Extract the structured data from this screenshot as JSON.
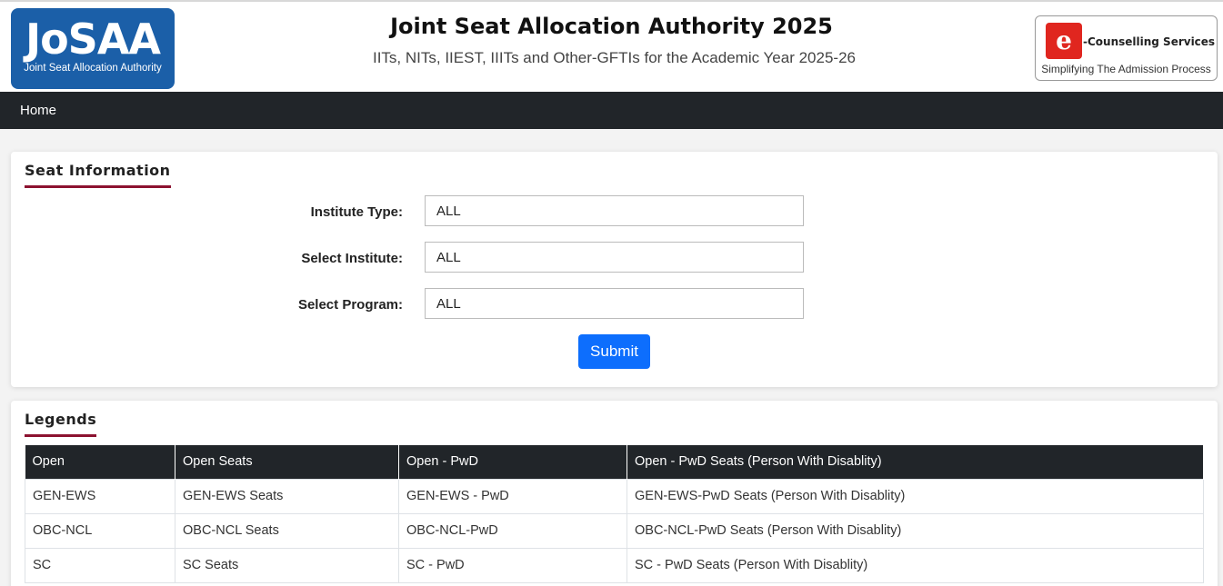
{
  "header": {
    "logo_text": "JoSAA",
    "logo_subtitle": "Joint Seat Allocation Authority",
    "title": "Joint Seat Allocation Authority 2025",
    "subtitle": "IITs, NITs, IIEST, IIITs and Other-GFTIs for the Academic Year 2025-26",
    "ecounselling_badge": "e",
    "ecounselling_label": "-Counselling Services",
    "ecounselling_tagline": "Simplifying The Admission Process"
  },
  "nav": {
    "home": "Home"
  },
  "seat_info": {
    "title": "Seat Information",
    "institute_type_label": "Institute Type:",
    "institute_type_value": "ALL",
    "institute_label": "Select Institute:",
    "institute_value": "ALL",
    "program_label": "Select Program:",
    "program_value": "ALL",
    "submit_label": "Submit"
  },
  "legends": {
    "title": "Legends",
    "header": [
      "Open",
      "Open Seats",
      "Open - PwD",
      "Open - PwD Seats (Person With Disablity)"
    ],
    "rows": [
      [
        "GEN-EWS",
        "GEN-EWS Seats",
        "GEN-EWS - PwD",
        "GEN-EWS-PwD Seats (Person With Disablity)"
      ],
      [
        "OBC-NCL",
        "OBC-NCL Seats",
        "OBC-NCL-PwD",
        "OBC-NCL-PwD Seats (Person With Disablity)"
      ],
      [
        "SC",
        "SC Seats",
        "SC - PwD",
        "SC - PwD Seats (Person With Disablity)"
      ]
    ]
  },
  "colors": {
    "nav_bg": "#212529",
    "accent_underline": "#8c1230",
    "submit_bg": "#0d6efd",
    "logo_bg": "#1b5fa8"
  }
}
